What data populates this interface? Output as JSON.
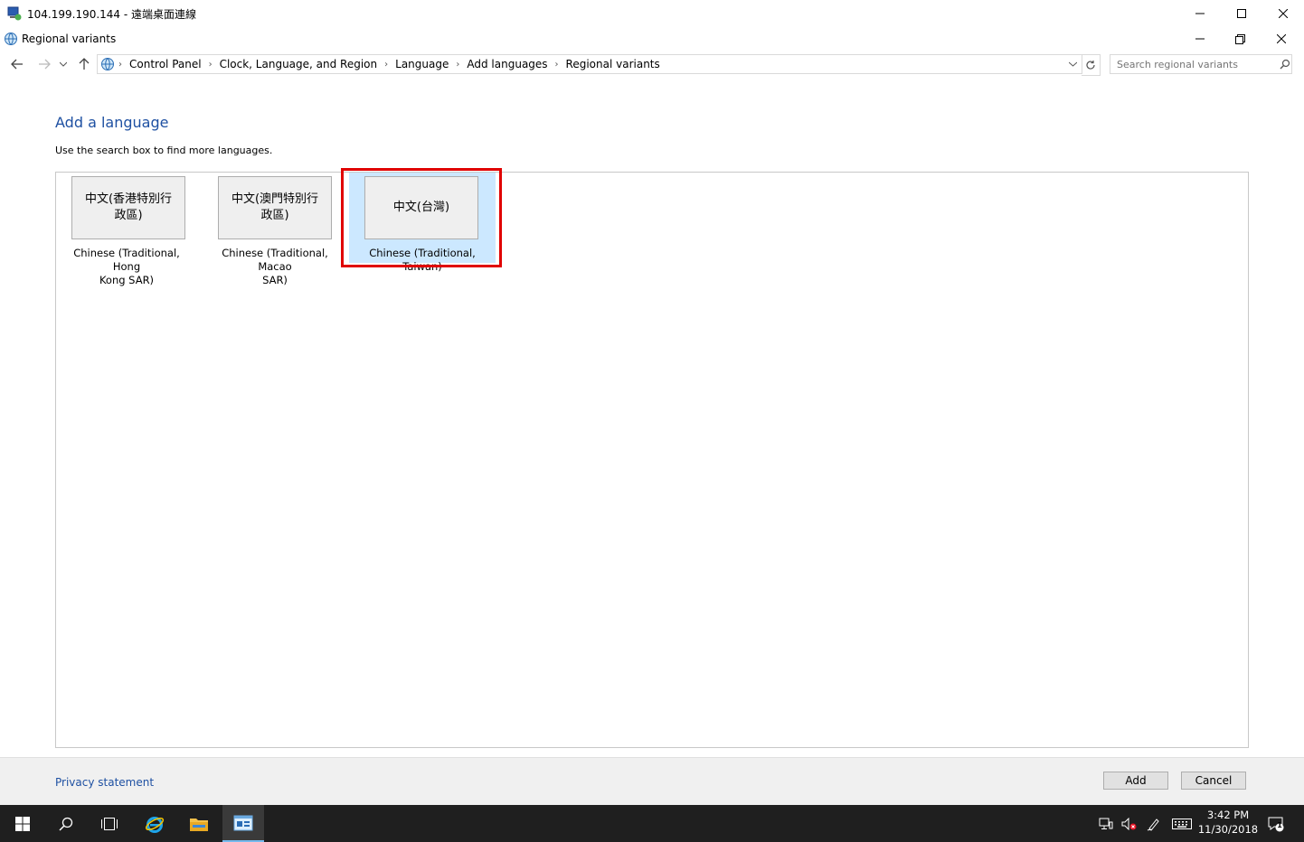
{
  "rdp": {
    "title": "104.199.190.144 - 遠端桌面連線"
  },
  "window": {
    "title": "Regional variants"
  },
  "breadcrumb": [
    "Control Panel",
    "Clock, Language, and Region",
    "Language",
    "Add languages",
    "Regional variants"
  ],
  "search": {
    "placeholder": "Search regional variants"
  },
  "main": {
    "heading": "Add a language",
    "subtext": "Use the search box to find more languages."
  },
  "languages": [
    {
      "native_line1": "中文(香港特別行",
      "native_line2": "政區)",
      "caption_line1": "Chinese (Traditional, Hong",
      "caption_line2": "Kong SAR)"
    },
    {
      "native_line1": "中文(澳門特別行",
      "native_line2": "政區)",
      "caption_line1": "Chinese (Traditional, Macao",
      "caption_line2": "SAR)"
    },
    {
      "native_line1": "中文(台灣)",
      "native_line2": "",
      "caption_line1": "Chinese (Traditional, Taiwan)",
      "caption_line2": ""
    }
  ],
  "footer": {
    "privacy": "Privacy statement",
    "add": "Add",
    "cancel": "Cancel"
  },
  "taskbar": {
    "time": "3:42 PM",
    "date": "11/30/2018",
    "notification_count": "1"
  },
  "colors": {
    "accent": "#1e50a2",
    "selection": "#cce8ff",
    "highlight": "#e00000",
    "taskbar": "#1f1f1f"
  }
}
